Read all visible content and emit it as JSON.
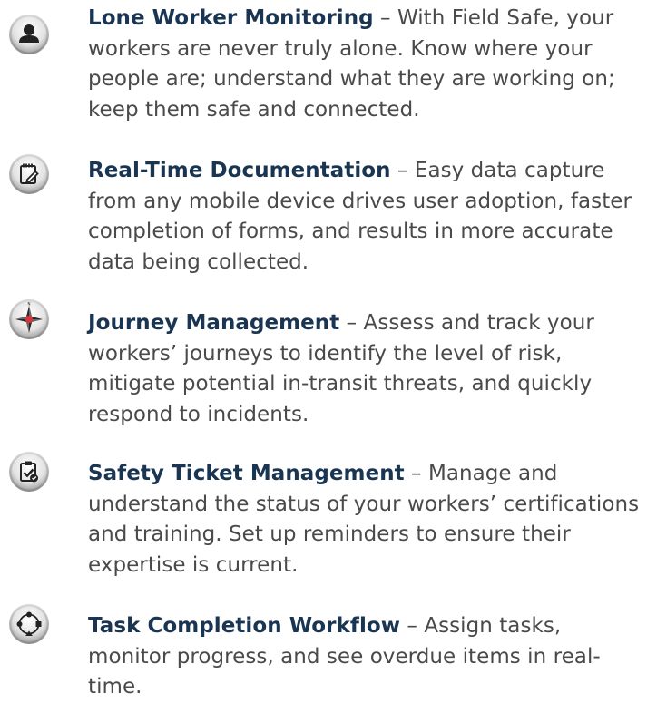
{
  "features": [
    {
      "icon": "lone-worker-person-icon",
      "title": "Lone Worker Monitoring",
      "separator": " – ",
      "description": "With Field Safe, your workers are never truly alone. Know where your people are; understand what they are working on; keep them safe and connected."
    },
    {
      "icon": "documentation-notepad-icon",
      "title": "Real-Time Documentation",
      "separator": " – ",
      "description": "Easy data capture from any mobile device drives user adoption, faster completion of forms, and results in more accurate data being collected."
    },
    {
      "icon": "compass-icon",
      "title": "Journey Management",
      "separator": " – ",
      "description": "Assess and track your workers’ journeys to identify the level of risk, mitigate potential in-transit threats, and quickly respond to incidents."
    },
    {
      "icon": "clipboard-check-icon",
      "title": "Safety Ticket Management",
      "separator": " – ",
      "description": "Manage and understand the status of your workers’ certifications and training. Set up reminders to ensure their expertise is current."
    },
    {
      "icon": "workflow-cycle-icon",
      "title": "Task Completion Workflow",
      "separator": " – ",
      "description": "Assign tasks, monitor progress, and see overdue items in real-time."
    }
  ],
  "compass_letter": "N"
}
